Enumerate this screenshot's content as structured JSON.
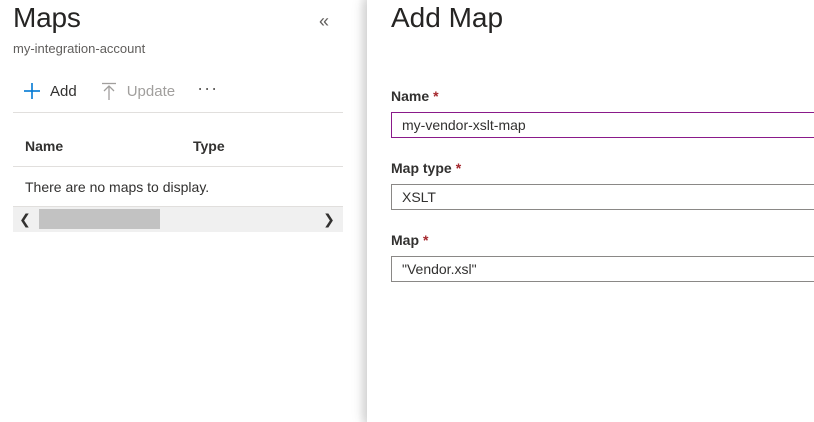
{
  "maps_blade": {
    "title": "Maps",
    "subtitle": "my-integration-account",
    "collapse_glyph": "«",
    "toolbar": {
      "add_label": "Add",
      "update_label": "Update",
      "more_glyph": "···"
    },
    "grid": {
      "columns": [
        "Name",
        "Type"
      ],
      "empty_message": "There are no maps to display."
    },
    "scrollbar": {
      "left_glyph": "❮",
      "right_glyph": "❯"
    }
  },
  "add_map_blade": {
    "title": "Add Map",
    "required_marker": "*",
    "fields": [
      {
        "label": "Name",
        "value": "my-vendor-xslt-map"
      },
      {
        "label": "Map type",
        "value": "XSLT"
      },
      {
        "label": "Map",
        "value": "\"Vendor.xsl\""
      }
    ]
  },
  "icons": {
    "add": "plus-icon",
    "update": "upload-arrow-icon",
    "collapse": "double-chevron-left-icon"
  },
  "colors": {
    "accent_blue": "#0078d4",
    "required_red": "#a4262c",
    "focused_border": "#8a1a8a",
    "disabled_text": "#a19f9d"
  }
}
